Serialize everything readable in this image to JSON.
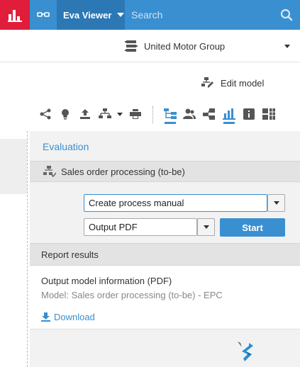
{
  "header": {
    "role_label": "Eva Viewer",
    "search_placeholder": "Search"
  },
  "database": {
    "name": "United Motor Group"
  },
  "toolbar": {
    "edit_model_label": "Edit model",
    "icons": [
      "share-icon",
      "lightbulb-icon",
      "upload-icon",
      "process-icon",
      "print-icon",
      "tree-icon",
      "users-icon",
      "objects-icon",
      "chart-icon",
      "info-icon",
      "grid-icon"
    ]
  },
  "panel": {
    "title": "Evaluation",
    "model_name": "Sales order processing (to-be)",
    "report_select_value": "Create process manual",
    "format_select_value": "Output PDF",
    "start_label": "Start",
    "results_header": "Report results",
    "result": {
      "title": "Output model information  (PDF)",
      "model_line": "Model: Sales order processing (to-be) - EPC",
      "download_label": "Download"
    }
  },
  "colors": {
    "accent": "#3a8fd0",
    "accent_dark": "#2c78b5",
    "logo_red": "#e01e3c",
    "panel_bg": "#f2f2f2",
    "header_bg": "#e3e3e3"
  }
}
